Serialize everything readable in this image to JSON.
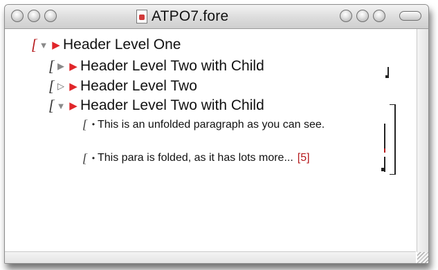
{
  "window": {
    "title": "ATPO7.fore",
    "file_icon": "document-icon"
  },
  "outline": {
    "header1": {
      "label": "Header Level One"
    },
    "header2_a": {
      "label": "Header Level Two with Child"
    },
    "header2_b": {
      "label": "Header Level Two"
    },
    "header2_c": {
      "label": "Header Level Two with Child"
    },
    "para1": {
      "text": "This is an unfolded paragraph as you can see."
    },
    "para2": {
      "text": "This para is folded, as it has lots more...",
      "count": "[5]"
    }
  },
  "colors": {
    "marker": "#e0262a",
    "bracket_accent": "#b5171a"
  }
}
